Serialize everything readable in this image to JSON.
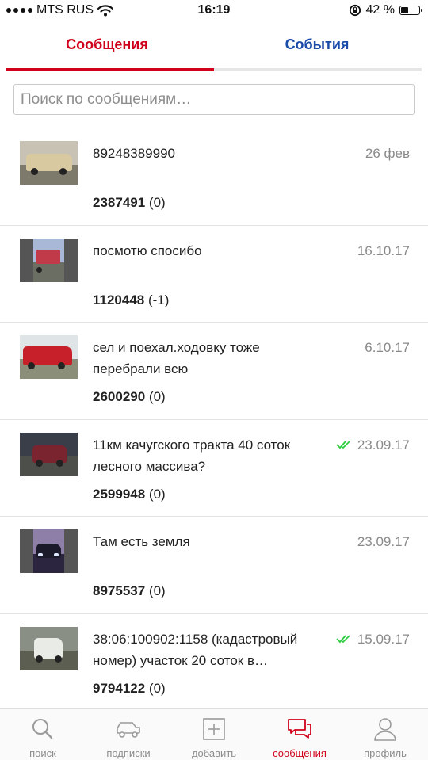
{
  "status_bar": {
    "carrier": "MTS RUS",
    "time": "16:19",
    "battery_text": "42 %",
    "battery_level": 0.42
  },
  "tabs": [
    {
      "label": "Сообщения",
      "active": true
    },
    {
      "label": "События",
      "active": false
    }
  ],
  "search": {
    "placeholder": "Поиск по сообщениям…",
    "value": ""
  },
  "conversations": [
    {
      "message": "89248389990",
      "date": "26 фев",
      "read": false,
      "id": "2387491",
      "count": "(0)"
    },
    {
      "message": "посмотю спосибо",
      "date": "16.10.17",
      "read": false,
      "id": "1120448",
      "count": "(-1)"
    },
    {
      "message": "сел и поехал.ходовку тоже перебрали всю",
      "date": "6.10.17",
      "read": false,
      "id": "2600290",
      "count": "(0)"
    },
    {
      "message": "11км качугского тракта 40 соток лесного массива?",
      "date": "23.09.17",
      "read": true,
      "id": "2599948",
      "count": "(0)"
    },
    {
      "message": "Там есть земля",
      "date": "23.09.17",
      "read": false,
      "id": "8975537",
      "count": "(0)"
    },
    {
      "message": "38:06:100902:1158 (кадастровый номер) участок 20 соток в…",
      "date": "15.09.17",
      "read": true,
      "id": "9794122",
      "count": "(0)"
    }
  ],
  "bottom_nav": [
    {
      "label": "поиск",
      "icon": "search-icon",
      "active": false
    },
    {
      "label": "подписки",
      "icon": "car-icon",
      "active": false
    },
    {
      "label": "добавить",
      "icon": "add-square-icon",
      "active": false
    },
    {
      "label": "сообщения",
      "icon": "chat-bubbles-icon",
      "active": true
    },
    {
      "label": "профиль",
      "icon": "profile-icon",
      "active": false
    }
  ],
  "colors": {
    "accent_red": "#d0021b",
    "events_blue": "#1a4ba8",
    "read_check_green": "#2ecc40",
    "muted_gray": "#8a8a8a"
  }
}
